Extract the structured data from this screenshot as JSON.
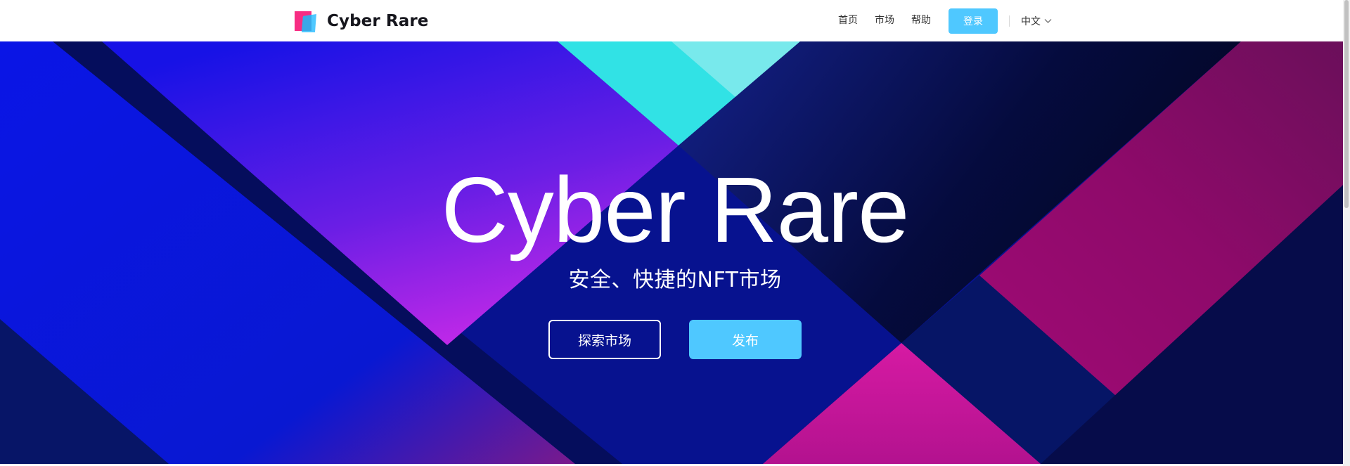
{
  "header": {
    "brand": "Cyber Rare",
    "nav": {
      "home": "首页",
      "market": "市场",
      "help": "帮助",
      "login": "登录",
      "language": "中文"
    }
  },
  "hero": {
    "title": "Cyber Rare",
    "subtitle": "安全、快捷的NFT市场",
    "explore_button": "探索市场",
    "publish_button": "发布"
  },
  "colors": {
    "accent": "#4fc8ff",
    "hero_base": "#07128f",
    "pink": "#d719a2",
    "cyan": "#31e2e5"
  },
  "icons": {
    "logo": "cyber-rare-logo-icon",
    "language_dropdown": "chevron-down-icon"
  }
}
